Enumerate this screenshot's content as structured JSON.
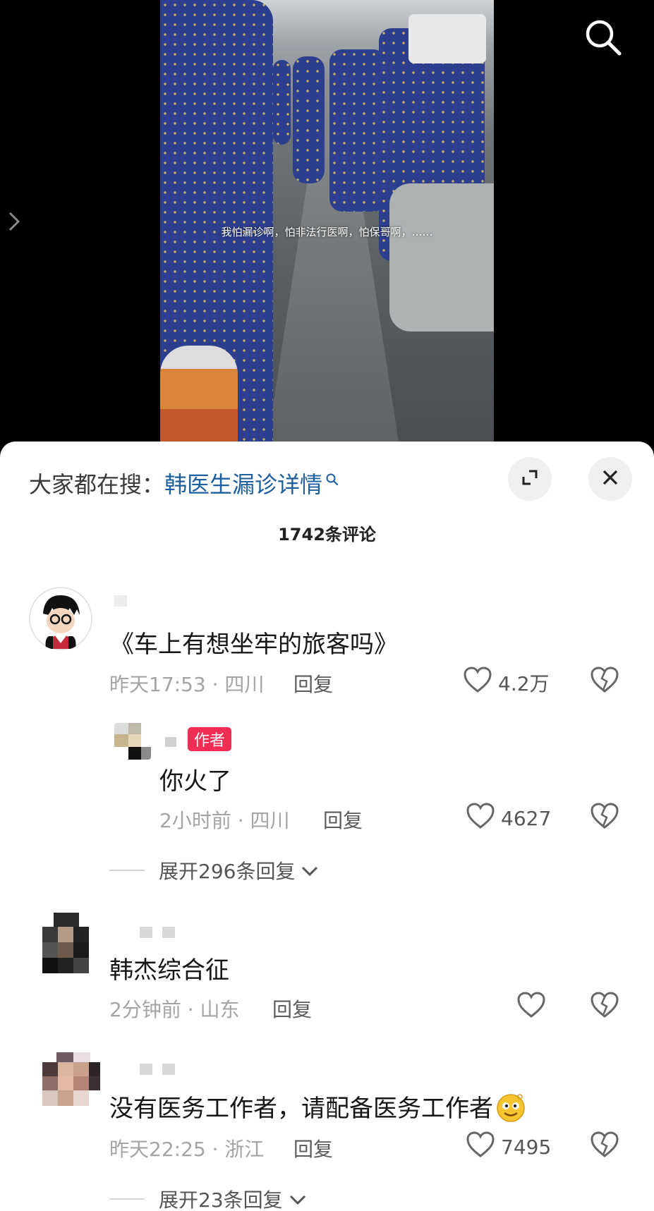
{
  "video": {
    "subtitle": "我怕漏诊啊，怕非法行医啊，怕保哥啊，……"
  },
  "sheet": {
    "search_prefix": "大家都在搜：",
    "search_term": "韩医生漏诊详情",
    "comment_count": "1742条评论"
  },
  "comments": [
    {
      "text": "《车上有想坐牢的旅客吗》",
      "time": "昨天17:53 · 四川",
      "reply_label": "回复",
      "likes": "4.2万"
    },
    {
      "author_tag": "作者",
      "text": "你火了",
      "time": "2小时前 · 四川",
      "reply_label": "回复",
      "likes": "4627"
    },
    {
      "expand": "展开296条回复"
    },
    {
      "text": "韩杰综合征",
      "time": "2分钟前 · 山东",
      "reply_label": "回复",
      "likes": ""
    },
    {
      "text": "没有医务工作者，请配备医务工作者",
      "time": "昨天22:25 · 浙江",
      "reply_label": "回复",
      "likes": "7495"
    },
    {
      "expand": "展开23条回复"
    }
  ],
  "colors": {
    "search_term": "#1e5fa0",
    "author_tag": "#f02d53"
  },
  "icons": [
    "search-icon",
    "chevron-right-icon",
    "expand-icon",
    "close-icon",
    "heart-icon",
    "broken-heart-icon",
    "chevron-down-icon",
    "emoji-icon"
  ]
}
